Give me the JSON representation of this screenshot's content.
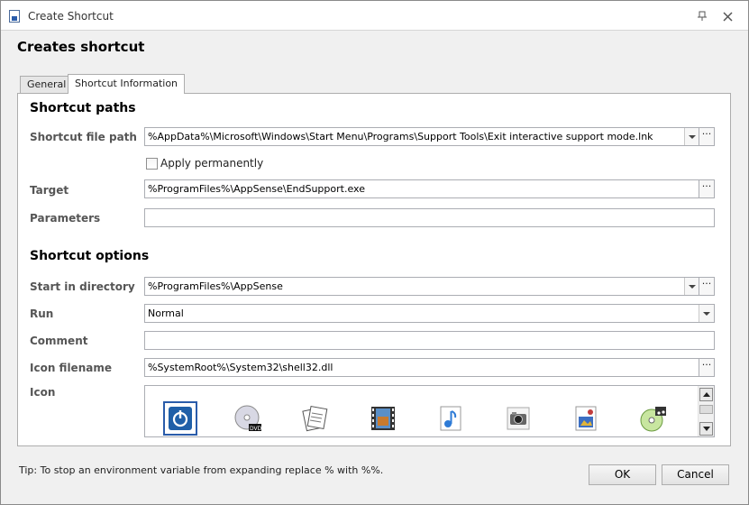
{
  "window": {
    "title": "Create Shortcut"
  },
  "dialog": {
    "heading": "Creates shortcut"
  },
  "tabs": [
    {
      "label": "General"
    },
    {
      "label": "Shortcut Information"
    }
  ],
  "paths": {
    "section_title": "Shortcut paths",
    "file_path_label": "Shortcut file path",
    "file_path_value": "%AppData%\\Microsoft\\Windows\\Start Menu\\Programs\\Support Tools\\Exit interactive support mode.lnk",
    "apply_permanently_label": "Apply permanently",
    "target_label": "Target",
    "target_value": "%ProgramFiles%\\AppSense\\EndSupport.exe",
    "parameters_label": "Parameters",
    "parameters_value": ""
  },
  "options": {
    "section_title": "Shortcut options",
    "start_dir_label": "Start in directory",
    "start_dir_value": "%ProgramFiles%\\AppSense",
    "run_label": "Run",
    "run_value": "Normal",
    "comment_label": "Comment",
    "comment_value": "",
    "icon_filename_label": "Icon filename",
    "icon_filename_value": "%SystemRoot%\\System32\\shell32.dll",
    "icon_label": "Icon"
  },
  "ellipsis": "···",
  "icons": [
    {
      "name": "power-icon",
      "selected": true
    },
    {
      "name": "dvd-disc-icon"
    },
    {
      "name": "documents-icon"
    },
    {
      "name": "film-icon"
    },
    {
      "name": "music-note-icon"
    },
    {
      "name": "camera-icon"
    },
    {
      "name": "media-file-icon"
    },
    {
      "name": "cd-music-icon"
    }
  ],
  "footer": {
    "tip": "Tip: To stop an environment variable from expanding replace % with %%.",
    "ok_label": "OK",
    "cancel_label": "Cancel"
  },
  "colors": {
    "accent": "#2a5caa"
  }
}
